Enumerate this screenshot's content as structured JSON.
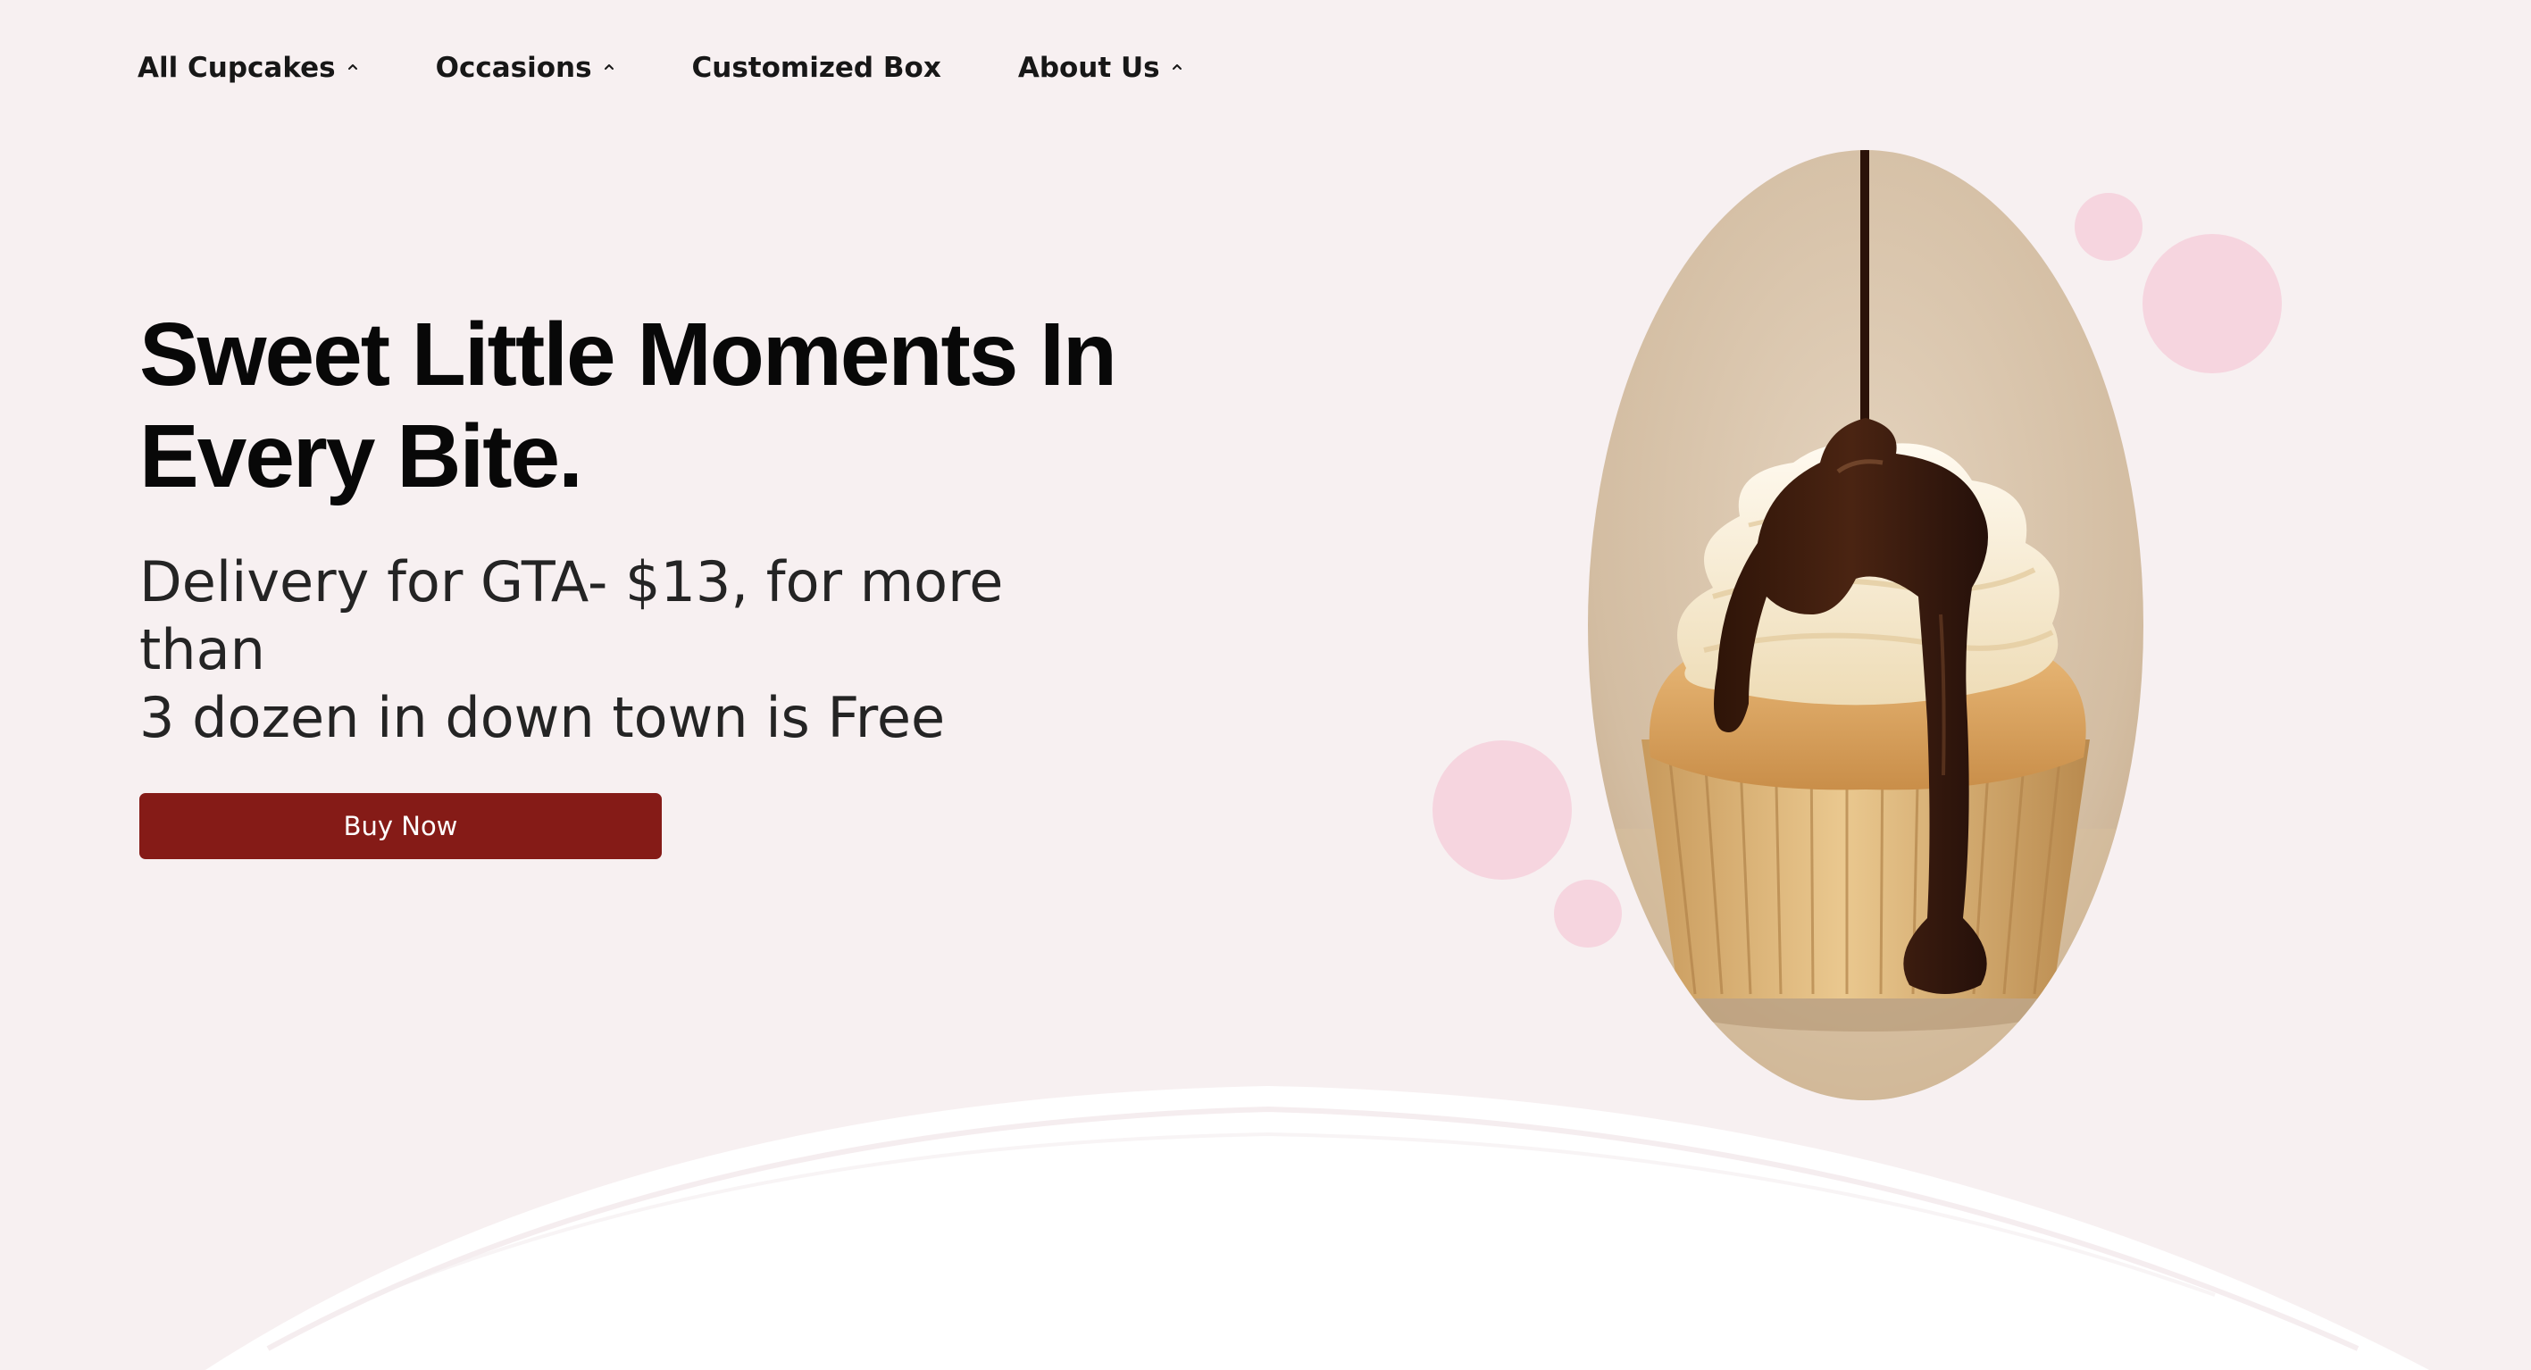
{
  "nav": {
    "items": [
      {
        "label": "All Cupcakes",
        "has_dropdown": true
      },
      {
        "label": "Occasions",
        "has_dropdown": true
      },
      {
        "label": "Customized Box",
        "has_dropdown": false
      },
      {
        "label": "About Us",
        "has_dropdown": true
      }
    ]
  },
  "hero": {
    "title_line1": "Sweet Little Moments In",
    "title_line2": "Every Bite.",
    "subtitle_line1": "Delivery for GTA- $13, for more than",
    "subtitle_line2": "3 dozen in down town is Free",
    "cta_label": "Buy Now",
    "image_subject": "cupcake-with-chocolate-drizzle"
  },
  "colors": {
    "background": "#f7f0f1",
    "cta_background": "#851b17",
    "cta_text": "#ffffff",
    "bubble": "#f6d5df",
    "wave": "#ffffff"
  }
}
